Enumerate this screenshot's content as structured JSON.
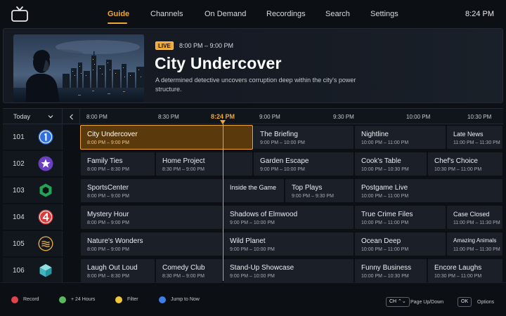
{
  "nav": {
    "items": [
      {
        "label": "Guide",
        "active": true
      },
      {
        "label": "Channels"
      },
      {
        "label": "On Demand"
      },
      {
        "label": "Recordings"
      },
      {
        "label": "Search"
      },
      {
        "label": "Settings"
      }
    ],
    "clock": "8:24 PM"
  },
  "hero": {
    "badge": "LIVE",
    "time": "8:00 PM – 9:00 PM",
    "title": "City Undercover",
    "description": "A determined detective uncovers corruption deep within the city's power structure."
  },
  "guide": {
    "day_label": "Today",
    "ticks": [
      "8:00 PM",
      "8:30 PM",
      "8:24 PM",
      "9:00 PM",
      "9:30 PM",
      "10:00 PM",
      "10:30 PM"
    ],
    "channels": [
      {
        "number": "101",
        "programs": [
          {
            "title": "City Undercover",
            "time": "8:00 PM – 9:00 PM",
            "selected": true
          },
          {
            "title": "The Briefing",
            "time": "9:00 PM – 10:00 PM"
          },
          {
            "title": "Nightline",
            "time": "10:00 PM – 11:00 PM"
          },
          {
            "title": "Late News",
            "time": "11:00 PM – 11:30 PM"
          }
        ]
      },
      {
        "number": "102",
        "programs": [
          {
            "title": "Family Ties",
            "time": "8:00 PM – 8:30 PM"
          },
          {
            "title": "Home Project",
            "time": "8:30 PM – 9:00 PM"
          },
          {
            "title": "Garden Escape",
            "time": "9:00 PM – 10:00 PM"
          },
          {
            "title": "Cook's Table",
            "time": "10:00 PM – 10:30 PM"
          },
          {
            "title": "Chef's Choice",
            "time": "10:30 PM – 11:00 PM"
          }
        ]
      },
      {
        "number": "103",
        "programs": [
          {
            "title": "SportsCenter",
            "time": "8:00 PM – 9:00 PM"
          },
          {
            "title": "Inside the Game",
            "time": ""
          },
          {
            "title": "Top Plays",
            "time": "9:00 PM – 9:30 PM"
          },
          {
            "title": "Postgame Live",
            "time": "10:00 PM – 11:00 PM"
          }
        ]
      },
      {
        "number": "104",
        "programs": [
          {
            "title": "Mystery Hour",
            "time": "8:00 PM – 9:00 PM"
          },
          {
            "title": "Shadows of Elmwood",
            "time": "9:00 PM – 10:00 PM"
          },
          {
            "title": "True Crime Files",
            "time": "10:00 PM – 11:00 PM"
          },
          {
            "title": "Case Closed",
            "time": "11:00 PM – 11:30 PM"
          }
        ]
      },
      {
        "number": "105",
        "programs": [
          {
            "title": "Nature's Wonders",
            "time": "8:00 PM – 9:00 PM"
          },
          {
            "title": "Wild Planet",
            "time": "9:00 PM – 10:00 PM"
          },
          {
            "title": "Ocean Deep",
            "time": "10:00 PM – 11:00 PM"
          },
          {
            "title": "Amazing Animals",
            "time": "11:00 PM – 11:30 PM"
          }
        ]
      },
      {
        "number": "106",
        "programs": [
          {
            "title": "Laugh Out Loud",
            "time": "8:00 PM – 8:30 PM"
          },
          {
            "title": "Comedy Club",
            "time": "8:30 PM – 9:00 PM"
          },
          {
            "title": "Stand-Up Showcase",
            "time": "9:00 PM – 10:00 PM"
          },
          {
            "title": "Funny Business",
            "time": "10:00 PM – 10:30 PM"
          },
          {
            "title": "Encore Laughs",
            "time": "10:30 PM – 11:00 PM"
          }
        ]
      }
    ]
  },
  "footer": {
    "legend": [
      {
        "label": "Record",
        "color": "#e0444b"
      },
      {
        "label": "+ 24 Hours",
        "color": "#5cb85c"
      },
      {
        "label": "Filter",
        "color": "#f0c63a"
      },
      {
        "label": "Jump to Now",
        "color": "#3d7ee8"
      }
    ],
    "ch_key": "CH ⌃⌄",
    "ch_label": "Page Up/Down",
    "ok_key": "OK",
    "ok_label": "Options"
  },
  "colors": {
    "accent": "#f0a733",
    "background": "#0c0f14"
  }
}
